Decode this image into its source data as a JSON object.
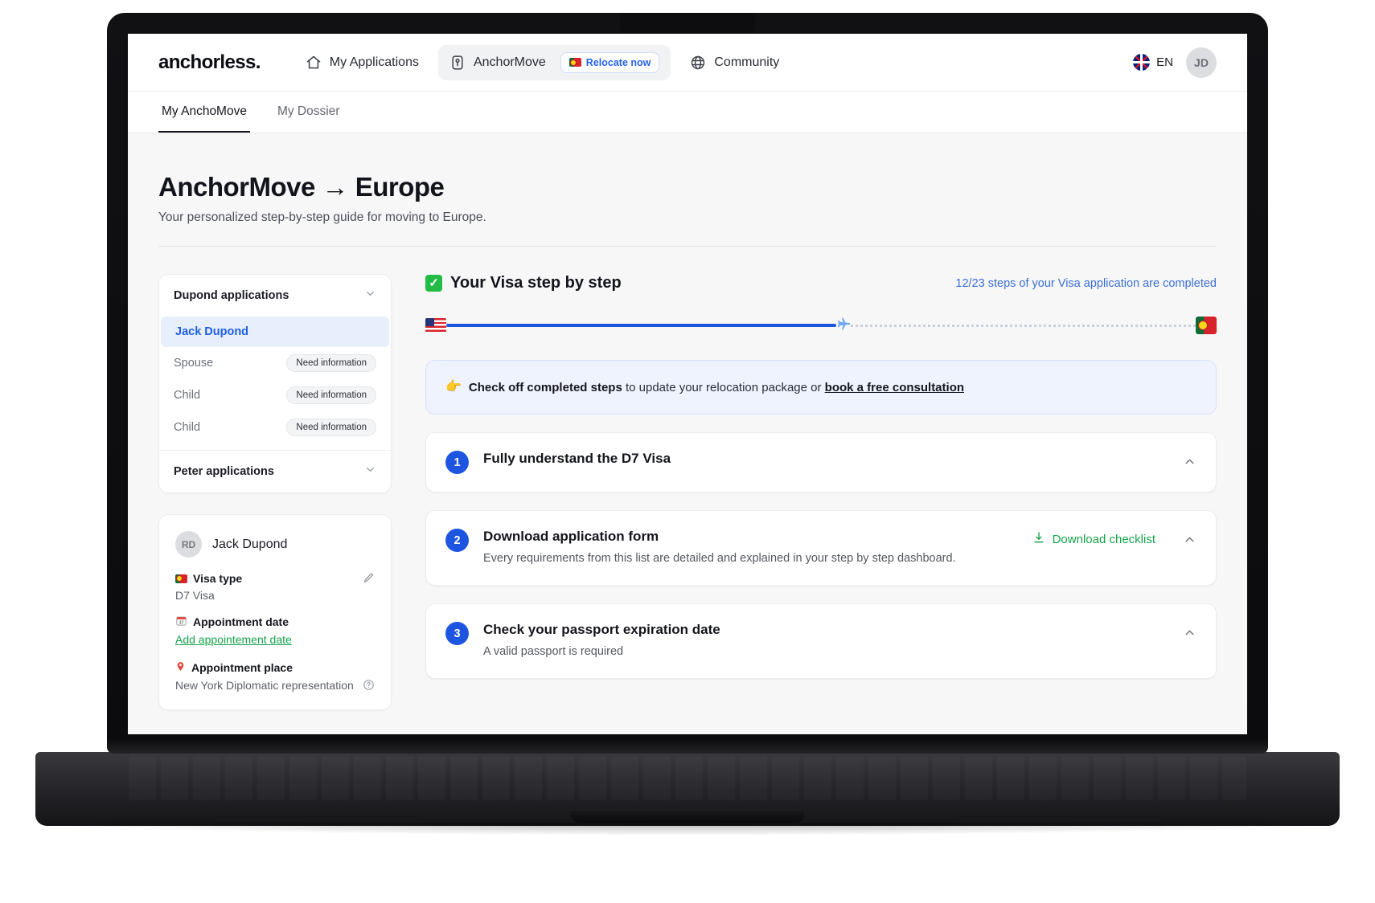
{
  "header": {
    "logo": "anchorless.",
    "nav": [
      {
        "label": "My Applications",
        "icon": "home-icon"
      },
      {
        "label": "AnchorMove",
        "icon": "id-card-icon",
        "badge": "Relocate now"
      },
      {
        "label": "Community",
        "icon": "globe-icon"
      }
    ],
    "language": "EN",
    "avatar_initials": "JD"
  },
  "tabs": [
    {
      "label": "My AnchoMove",
      "active": true
    },
    {
      "label": "My Dossier",
      "active": false
    }
  ],
  "page": {
    "title": "AnchorMove → Europe",
    "subtitle": "Your personalized step-by-step guide for moving to Europe."
  },
  "applications": {
    "group1_title": "Dupond applications",
    "rows": [
      {
        "label": "Jack Dupond",
        "badge": "",
        "selected": true
      },
      {
        "label": "Spouse",
        "badge": "Need information",
        "selected": false
      },
      {
        "label": "Child",
        "badge": "Need information",
        "selected": false
      },
      {
        "label": "Child",
        "badge": "Need information",
        "selected": false
      }
    ],
    "group2_title": "Peter applications"
  },
  "profile": {
    "avatar_initials": "RD",
    "name": "Jack Dupond",
    "visa_type_label": "Visa type",
    "visa_type_value": "D7 Visa",
    "appointment_date_label": "Appointment date",
    "appointment_date_link": "Add appointement date",
    "appointment_place_label": "Appointment place",
    "appointment_place_value": "New York Diplomatic representation"
  },
  "visa": {
    "heading": "Your Visa step by step",
    "check_glyph": "✓",
    "steps_completed_text": "12/23 steps of your Visa application are completed",
    "progress": {
      "completed": 12,
      "total": 23,
      "percent": 52,
      "from_flag": "us-flag",
      "to_flag": "pt-flag"
    },
    "notice": {
      "emoji": "👉",
      "bold": "Check off completed steps",
      "middle": " to update your relocation package or ",
      "link": "book a free consultation"
    },
    "steps": [
      {
        "number": "1",
        "title": "Fully understand the D7 Visa",
        "desc": "",
        "action": ""
      },
      {
        "number": "2",
        "title": "Download application form",
        "desc": "Every requirements from this list are detailed and explained in your step by step dashboard.",
        "action": "Download checklist"
      },
      {
        "number": "3",
        "title": "Check your passport expiration date",
        "desc": "A valid passport is required",
        "action": ""
      }
    ]
  },
  "colors": {
    "accent_blue": "#1d55e0",
    "link_blue": "#3b6fd4",
    "green": "#16a34a",
    "notice_bg": "#eef3fe"
  }
}
